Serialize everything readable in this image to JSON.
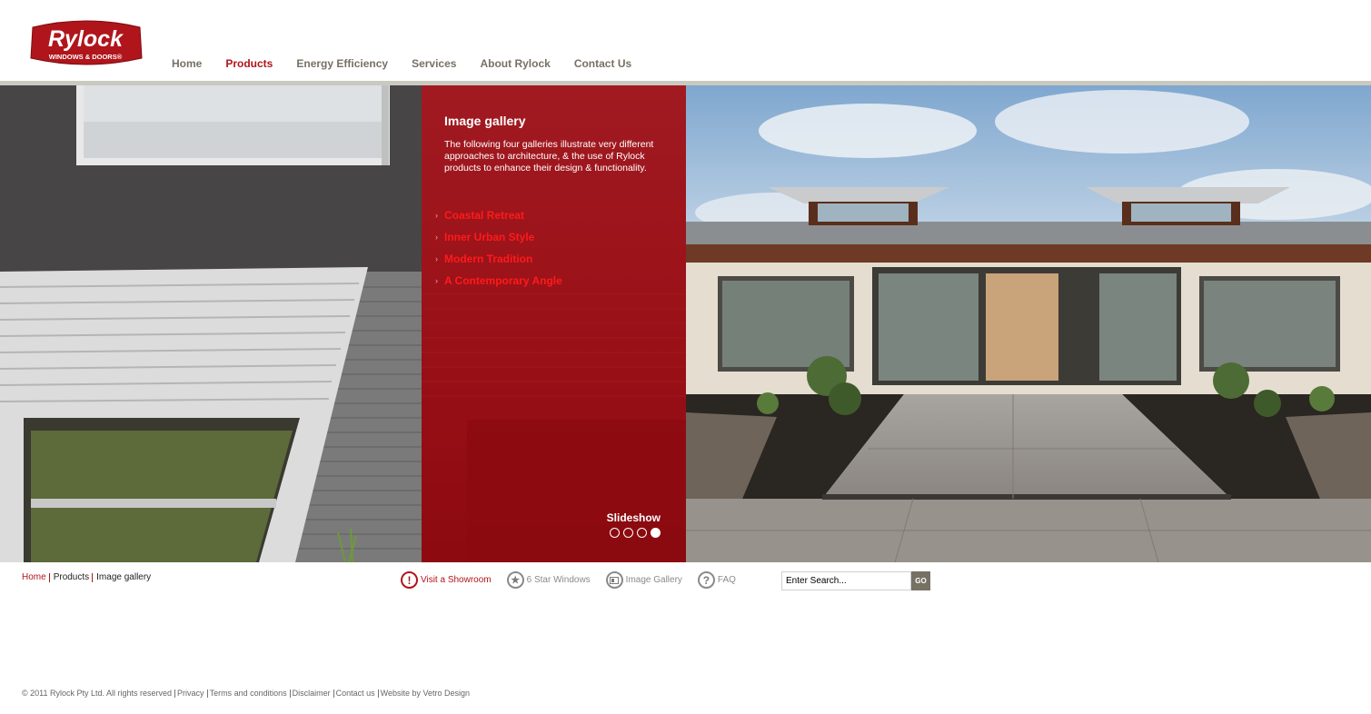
{
  "brand": {
    "name": "Rylock",
    "tagline": "WINDOWS & DOORS®",
    "logo_color": "#b0151b"
  },
  "nav": {
    "items": [
      {
        "label": "Home",
        "active": false
      },
      {
        "label": "Products",
        "active": true
      },
      {
        "label": "Energy Efficiency",
        "active": false
      },
      {
        "label": "Services",
        "active": false
      },
      {
        "label": "About Rylock",
        "active": false
      },
      {
        "label": "Contact Us",
        "active": false
      }
    ]
  },
  "hero": {
    "title": "Image gallery",
    "intro": "The following four galleries illustrate very different approaches to architecture, & the use of Rylock products to enhance their design & functionality.",
    "galleries": [
      {
        "label": "Coastal Retreat"
      },
      {
        "label": "Inner Urban Style"
      },
      {
        "label": "Modern Tradition"
      },
      {
        "label": "A Contemporary Angle"
      }
    ],
    "slideshow_label": "Slideshow",
    "slides": [
      {
        "active": false
      },
      {
        "active": false
      },
      {
        "active": false
      },
      {
        "active": true
      }
    ]
  },
  "breadcrumb": {
    "home": "Home",
    "products": "Products",
    "current": "Image gallery"
  },
  "quicklinks": [
    {
      "label": "Visit a Showroom",
      "icon": "exclamation-icon"
    },
    {
      "label": "6 Star Windows",
      "icon": "star-icon"
    },
    {
      "label": "Image Gallery",
      "icon": "gallery-icon"
    },
    {
      "label": "FAQ",
      "icon": "question-icon"
    }
  ],
  "search": {
    "value": "Enter Search...",
    "button_label": "GO"
  },
  "footer": {
    "copyright": "© 2011 Rylock Pty Ltd. All rights reserved",
    "links": [
      "Privacy",
      "Terms and conditions",
      "Disclaimer",
      "Contact us",
      "Website by Vetro Design"
    ]
  },
  "colors": {
    "accent": "#b0151b",
    "nav_text": "#777064",
    "panel": "#9a1017"
  }
}
